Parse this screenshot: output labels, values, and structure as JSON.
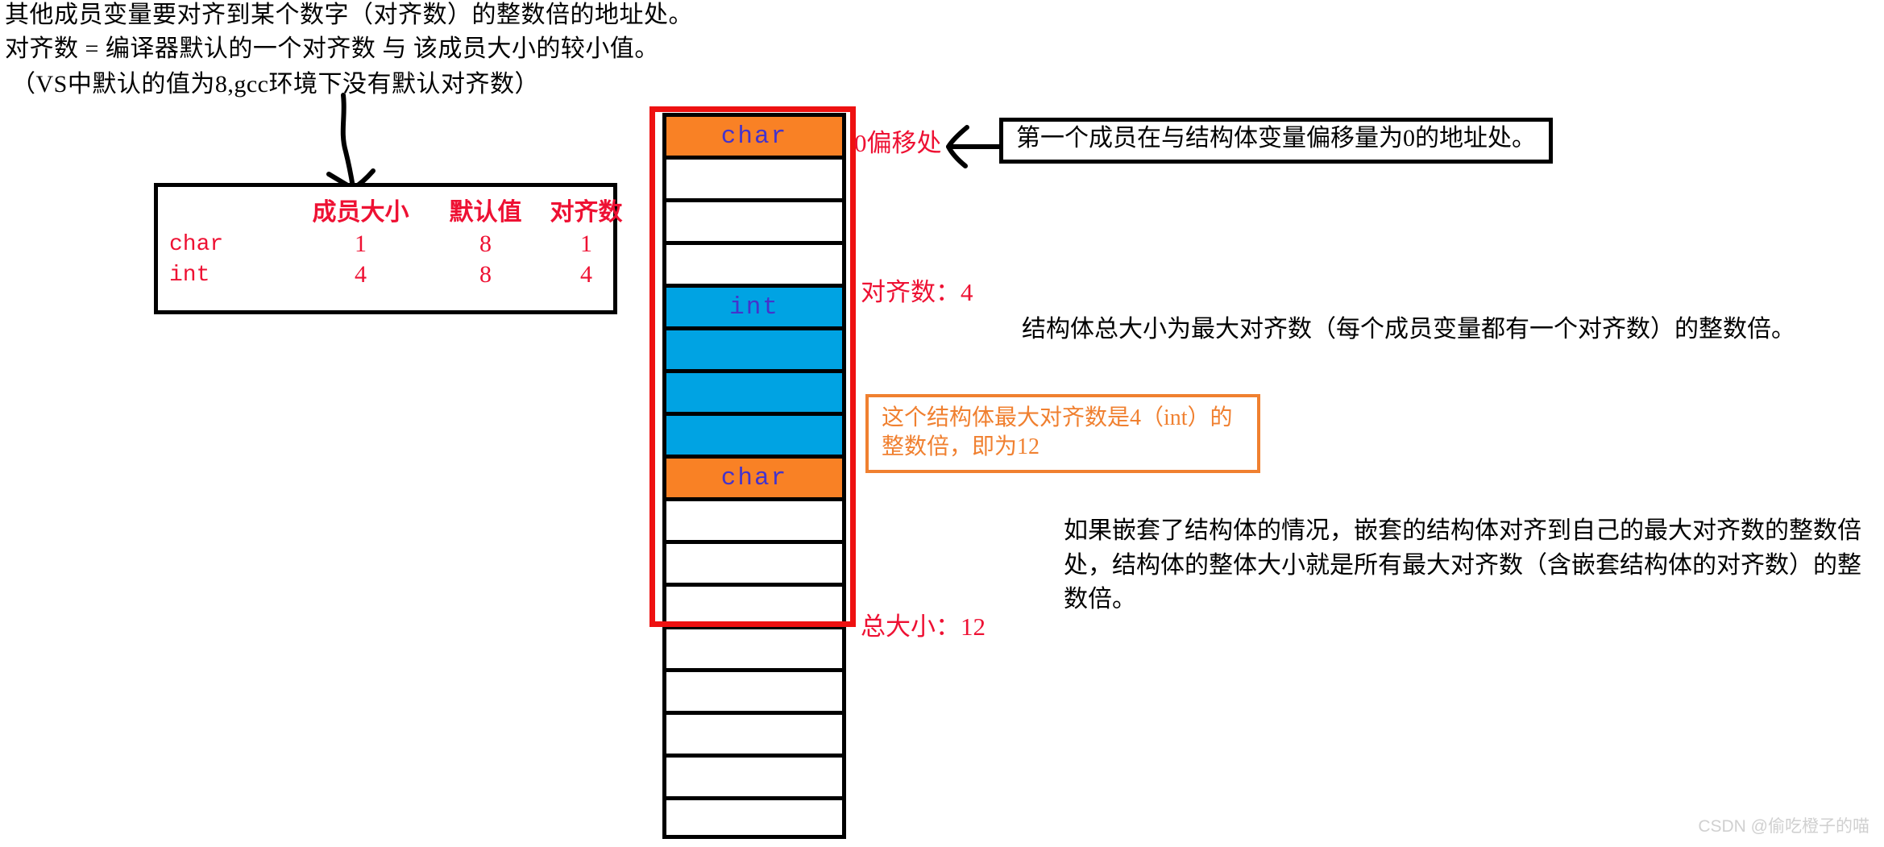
{
  "notes": {
    "line1": "其他成员变量要对齐到某个数字（对齐数）的整数倍的地址处。",
    "line2": "对齐数 = 编译器默认的一个对齐数 与 该成员大小的较小值。",
    "line3": "（VS中默认的值为8,gcc环境下没有默认对齐数）"
  },
  "align_table": {
    "headers": [
      "",
      "成员大小",
      "默认值",
      "对齐数"
    ],
    "rows": [
      {
        "type": "char",
        "member_size": "1",
        "default_value": "8",
        "alignment": "1"
      },
      {
        "type": "int",
        "member_size": "4",
        "default_value": "8",
        "alignment": "4"
      }
    ]
  },
  "memory": {
    "cells": [
      {
        "label": "char",
        "fill": "orange"
      },
      {
        "label": "",
        "fill": "white"
      },
      {
        "label": "",
        "fill": "white"
      },
      {
        "label": "",
        "fill": "white"
      },
      {
        "label": "int",
        "fill": "blue"
      },
      {
        "label": "",
        "fill": "blue"
      },
      {
        "label": "",
        "fill": "blue"
      },
      {
        "label": "",
        "fill": "blue"
      },
      {
        "label": "char",
        "fill": "orange"
      },
      {
        "label": "",
        "fill": "white"
      },
      {
        "label": "",
        "fill": "white"
      },
      {
        "label": "",
        "fill": "white"
      },
      {
        "label": "",
        "fill": "white"
      },
      {
        "label": "",
        "fill": "white"
      },
      {
        "label": "",
        "fill": "white"
      },
      {
        "label": "",
        "fill": "white"
      },
      {
        "label": "",
        "fill": "white"
      }
    ],
    "colors": {
      "orange": "#f98125",
      "blue": "#00a3e3",
      "white": "#ffffff",
      "highlight_box": "#ee1111",
      "label_text": "#4433cc"
    }
  },
  "labels": {
    "offset_zero": "0偏移处",
    "alignment_value": "对齐数：4",
    "total_size": "总大小：12"
  },
  "callouts": {
    "first_member": "第一个成员在与结构体变量偏移量为0的地址处。",
    "max_alignment_line1": "这个结构体最大对齐数是4（int）的",
    "max_alignment_line2": "整数倍，即为12"
  },
  "paragraphs": {
    "total_size_rule": "结构体总大小为最大对齐数（每个成员变量都有一个对齐数）的整数倍。",
    "nested_struct_rule": "如果嵌套了结构体的情况，嵌套的结构体对齐到自己的最大对齐数的整数倍处，结构体的整体大小就是所有最大对齐数（含嵌套结构体的对齐数）的整数倍。"
  },
  "watermark": "CSDN @偷吃橙子的喵"
}
